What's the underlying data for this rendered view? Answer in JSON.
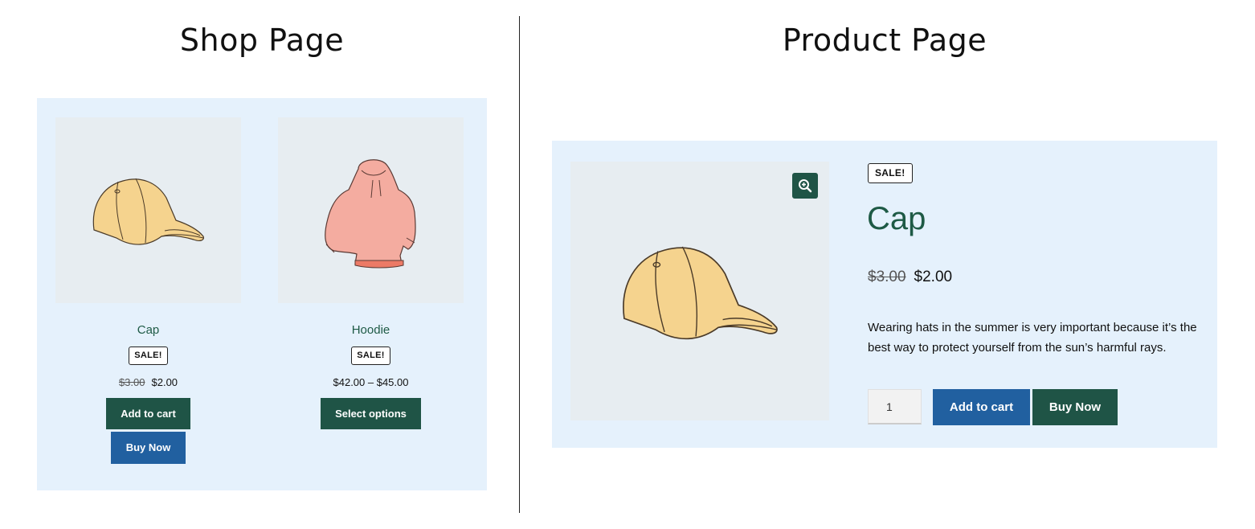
{
  "headings": {
    "shop": "Shop Page",
    "product": "Product Page"
  },
  "colors": {
    "accent_green": "#1f5446",
    "accent_blue": "#2160a0",
    "panel_bg": "#e5f1fc",
    "image_bg": "#e7edf1"
  },
  "shop": {
    "products": [
      {
        "title": "Cap",
        "badge": "SALE!",
        "price_old": "$3.00",
        "price_new": "$2.00",
        "add_to_cart": "Add to cart",
        "buy_now": "Buy Now",
        "icon": "cap-illustration"
      },
      {
        "title": "Hoodie",
        "badge": "SALE!",
        "price_range": "$42.00 – $45.00",
        "select_options": "Select options",
        "icon": "hoodie-illustration"
      }
    ]
  },
  "product": {
    "badge": "SALE!",
    "title": "Cap",
    "price_old": "$3.00",
    "price_new": "$2.00",
    "description": "Wearing hats in the summer is very important because it’s the best way to protect yourself from the sun’s harmful rays.",
    "quantity": "1",
    "add_to_cart": "Add to cart",
    "buy_now": "Buy Now",
    "zoom_icon": "zoom-in-icon"
  }
}
